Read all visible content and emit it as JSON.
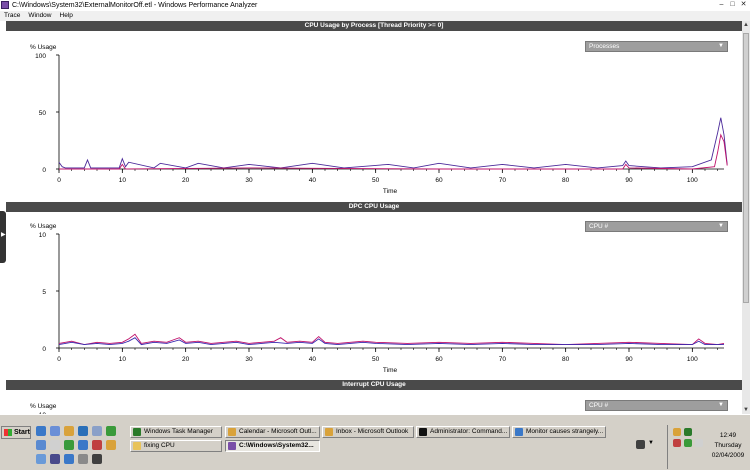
{
  "window": {
    "title": "C:\\Windows\\System32\\ExternalMonitorOff.etl - Windows Performance Analyzer"
  },
  "menu": [
    "Trace",
    "Window",
    "Help"
  ],
  "panels": [
    {
      "title": "CPU Usage by Process [Thread Priority >= 0]",
      "dropdown": "Processes",
      "ylabel": "% Usage",
      "yticks": [
        "100",
        "50",
        "0"
      ],
      "xlabel": "Time"
    },
    {
      "title": "DPC CPU Usage",
      "dropdown": "CPU #",
      "ylabel": "% Usage",
      "yticks": [
        "10",
        "5",
        "0"
      ],
      "xlabel": "Time"
    },
    {
      "title": "Interrupt CPU Usage",
      "dropdown": "CPU #",
      "ylabel": "% Usage",
      "yticks": [
        "10"
      ]
    }
  ],
  "chart_data": [
    {
      "type": "line",
      "title": "CPU Usage by Process [Thread Priority >= 0]",
      "xlabel": "Time",
      "ylabel": "% Usage",
      "xlim": [
        0,
        105
      ],
      "ylim": [
        0,
        100
      ],
      "xticks": [
        0,
        10,
        20,
        30,
        40,
        50,
        60,
        70,
        80,
        90,
        100
      ],
      "yticks": [
        0,
        50,
        100
      ],
      "series": [
        {
          "color": "#4b2a9a",
          "x": [
            0,
            0.5,
            1,
            4,
            4.5,
            5,
            9.5,
            10,
            10.5,
            11,
            15,
            16,
            20,
            22,
            26,
            30,
            35,
            40,
            45,
            52,
            56,
            60,
            65,
            70,
            75,
            80,
            85,
            89,
            89.5,
            90,
            95,
            100,
            103,
            104,
            104.5,
            105,
            105.5
          ],
          "y": [
            6,
            2,
            1,
            1,
            8,
            1,
            1,
            9,
            2,
            6,
            1,
            5,
            1,
            5,
            1,
            4,
            1,
            5,
            1,
            4,
            1,
            5,
            1,
            4,
            1,
            4,
            1,
            3,
            7,
            3,
            1,
            2,
            8,
            32,
            45,
            30,
            4
          ]
        },
        {
          "color": "#c0116a",
          "x": [
            0,
            9.5,
            10,
            10.5,
            30,
            60,
            89,
            89.5,
            90,
            100,
            103.5,
            104,
            104.5,
            105,
            105.5
          ],
          "y": [
            0,
            0,
            4,
            0,
            1,
            0,
            0,
            4,
            1,
            0,
            2,
            15,
            30,
            24,
            3
          ]
        }
      ]
    },
    {
      "type": "line",
      "title": "DPC CPU Usage",
      "xlabel": "Time",
      "ylabel": "% Usage",
      "xlim": [
        0,
        105
      ],
      "ylim": [
        0,
        10
      ],
      "xticks": [
        0,
        10,
        20,
        30,
        40,
        50,
        60,
        70,
        80,
        90,
        100
      ],
      "yticks": [
        0,
        5,
        10
      ],
      "series": [
        {
          "color": "#c0116a",
          "x": [
            0,
            2,
            4,
            6,
            8,
            10,
            11,
            12,
            13,
            15,
            17,
            18,
            19,
            20,
            22,
            24,
            26,
            28,
            30,
            32,
            34,
            35,
            36,
            38,
            40,
            41,
            42,
            44,
            46,
            48,
            50,
            55,
            60,
            65,
            70,
            75,
            80,
            85,
            90,
            95,
            100,
            101,
            102,
            104,
            105
          ],
          "y": [
            0.4,
            0.6,
            0.3,
            0.5,
            0.4,
            0.5,
            0.8,
            1.2,
            0.4,
            0.6,
            0.5,
            0.7,
            0.9,
            0.5,
            0.6,
            0.4,
            0.5,
            0.6,
            0.4,
            0.5,
            0.6,
            0.9,
            0.5,
            0.6,
            0.5,
            1.0,
            0.5,
            0.4,
            0.5,
            0.6,
            0.5,
            0.4,
            0.5,
            0.4,
            0.5,
            0.4,
            0.3,
            0.4,
            0.5,
            0.4,
            0.3,
            0.8,
            0.4,
            0.3,
            0.4
          ]
        },
        {
          "color": "#3a2ab0",
          "x": [
            0,
            2,
            4,
            6,
            8,
            10,
            11,
            12,
            13,
            15,
            17,
            19,
            20,
            22,
            24,
            26,
            28,
            30,
            32,
            34,
            36,
            38,
            40,
            41,
            42,
            44,
            46,
            48,
            50,
            55,
            60,
            65,
            70,
            75,
            80,
            85,
            90,
            95,
            100,
            101,
            102,
            104,
            105
          ],
          "y": [
            0.3,
            0.5,
            0.3,
            0.4,
            0.3,
            0.4,
            0.6,
            0.9,
            0.3,
            0.5,
            0.4,
            0.7,
            0.4,
            0.5,
            0.3,
            0.4,
            0.5,
            0.3,
            0.4,
            0.5,
            0.4,
            0.5,
            0.4,
            0.8,
            0.4,
            0.3,
            0.4,
            0.5,
            0.4,
            0.3,
            0.4,
            0.3,
            0.4,
            0.3,
            0.3,
            0.3,
            0.4,
            0.3,
            0.3,
            0.6,
            0.3,
            0.3,
            0.3
          ]
        }
      ]
    }
  ],
  "taskbar": {
    "start_label": "Start",
    "buttons": [
      {
        "label": "Windows Task Manager",
        "color": "#2a7a2a"
      },
      {
        "label": "Calendar - Microsoft Outl...",
        "color": "#d9a23a"
      },
      {
        "label": "Inbox - Microsoft Outlook",
        "color": "#d9a23a"
      },
      {
        "label": "Administrator: Command...",
        "color": "#111111"
      },
      {
        "label": "Monitor causes strangely...",
        "color": "#3a78c8"
      },
      {
        "label": "fixing CPU",
        "color": "#e8c35a"
      },
      {
        "label": "C:\\Windows\\System32...",
        "color": "#7a4ea8"
      }
    ],
    "clock": {
      "time": "12:49",
      "day": "Thursday",
      "date": "02/04/2009"
    }
  },
  "colors": {
    "panel_header": "#4a4a4a",
    "dropdown": "#9e9e9e",
    "series_a": "#4b2a9a",
    "series_b": "#c0116a"
  }
}
